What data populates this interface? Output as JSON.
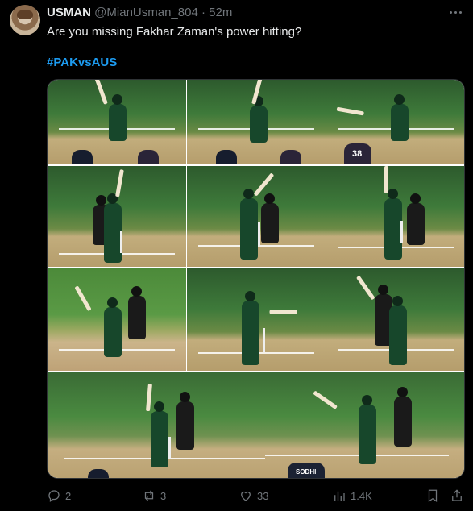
{
  "tweet": {
    "author_name": "USMAN",
    "author_handle": "@MianUsman_804",
    "separator": "·",
    "time": "52m",
    "text": "Are you missing Fakhar Zaman's power hitting?",
    "hashtag": "#PAKvsAUS"
  },
  "media": {
    "shirt_labels": [
      "38",
      "SODHI"
    ]
  },
  "actions": {
    "replies": "2",
    "reposts": "3",
    "likes": "33",
    "views": "1.4K"
  },
  "icons": [
    "more-icon",
    "reply-icon",
    "repost-icon",
    "like-icon",
    "views-icon",
    "bookmark-icon",
    "share-icon"
  ],
  "colors": {
    "accent": "#1d9bf0",
    "text": "#e7e9ea",
    "muted": "#71767b",
    "background": "#000000"
  }
}
